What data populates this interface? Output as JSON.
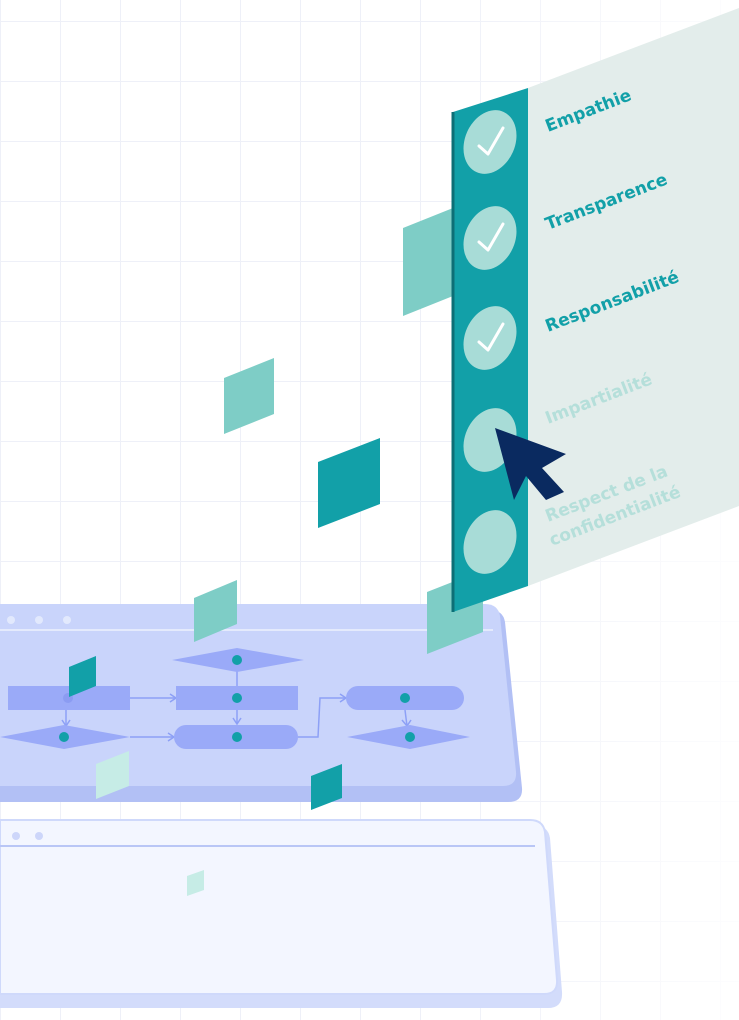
{
  "checklist": {
    "items": [
      {
        "label": "Empathie",
        "checked": true
      },
      {
        "label": "Transparence",
        "checked": true
      },
      {
        "label": "Responsabilité",
        "checked": true
      },
      {
        "label": "Impartialité",
        "checked": false
      },
      {
        "label_line1": "Respect de la",
        "label_line2": "confidentialité",
        "checked": false
      }
    ]
  },
  "colors": {
    "teal": "#12a0a8",
    "teal_light": "#7ecdc6",
    "panel_bg": "#e3edeb",
    "screen_blue": "#c9d4fb",
    "shape_blue": "#9aaaf8",
    "cursor": "#0a2a60"
  }
}
